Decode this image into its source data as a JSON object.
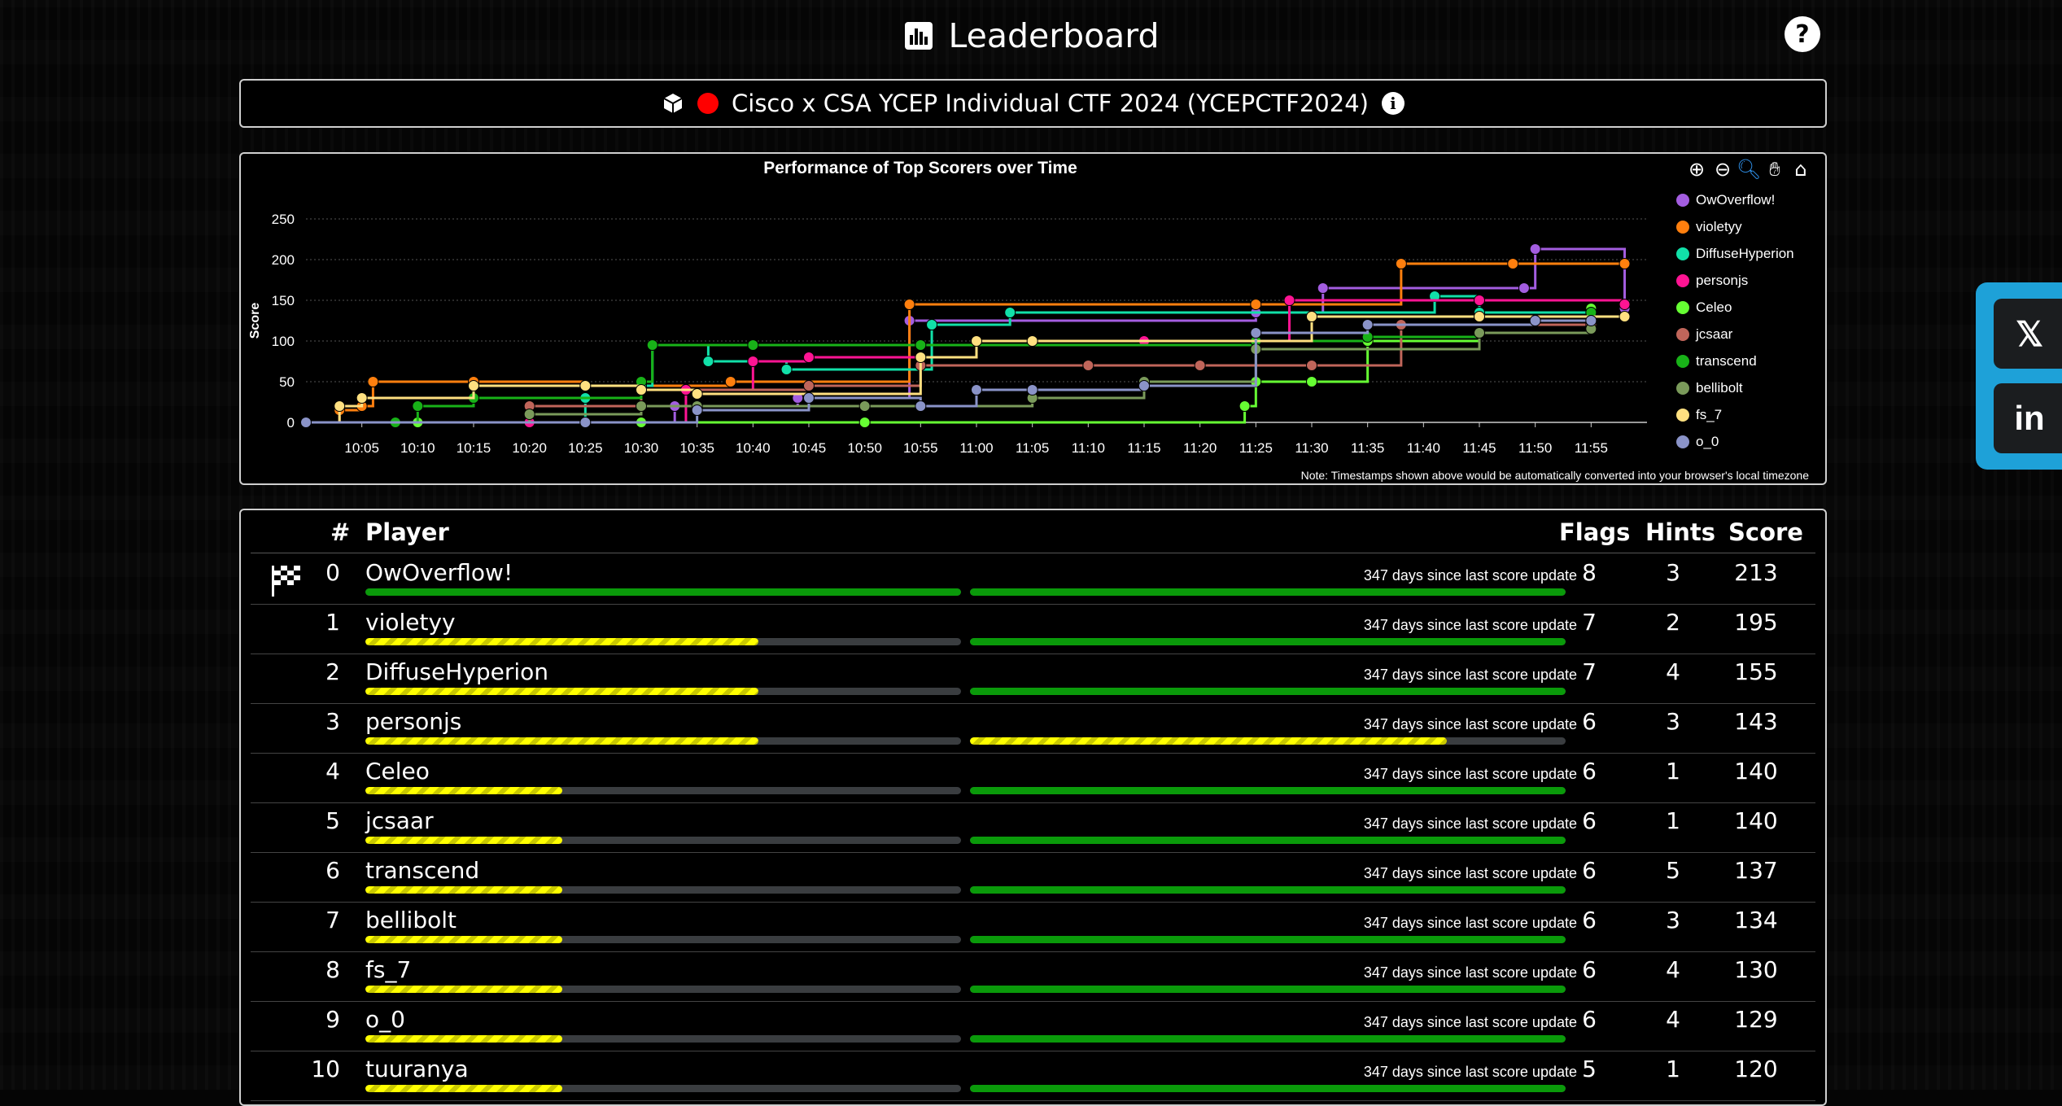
{
  "header": {
    "title": "Leaderboard",
    "help_label": "?"
  },
  "event": {
    "name": "Cisco x CSA YCEP Individual CTF 2024 (YCEPCTF2024)"
  },
  "chart": {
    "note": "Note: Timestamps shown above would be automatically converted into your browser's local timezone",
    "tools": [
      "zoom-in-icon",
      "zoom-out-icon",
      "selection-zoom-icon",
      "pan-icon",
      "home-icon"
    ]
  },
  "chart_data": {
    "type": "line",
    "title": "Performance of Top Scorers over Time",
    "xlabel": "",
    "ylabel": "Score",
    "ylim": [
      0,
      250
    ],
    "yticks": [
      0,
      50,
      100,
      150,
      200,
      250
    ],
    "xticks": [
      "10:05",
      "10:10",
      "10:15",
      "10:20",
      "10:25",
      "10:30",
      "10:35",
      "10:40",
      "10:45",
      "10:50",
      "10:55",
      "11:00",
      "11:05",
      "11:10",
      "11:15",
      "11:20",
      "11:25",
      "11:30",
      "11:35",
      "11:40",
      "11:45",
      "11:50",
      "11:55"
    ],
    "x_start": "10:00",
    "legend_position": "right",
    "grid": true,
    "series": [
      {
        "name": "OwOverflow!",
        "color": "#a35de0",
        "x": [
          "10:00",
          "10:33",
          "10:44",
          "10:54",
          "11:25",
          "11:31",
          "11:49",
          "11:50",
          "11:58"
        ],
        "y": [
          0,
          20,
          30,
          125,
          135,
          165,
          165,
          213,
          140
        ]
      },
      {
        "name": "violetyy",
        "color": "#ff7f0e",
        "x": [
          "10:00",
          "10:03",
          "10:05",
          "10:06",
          "10:15",
          "10:25",
          "10:38",
          "10:54",
          "11:25",
          "11:38",
          "11:48",
          "11:58"
        ],
        "y": [
          0,
          15,
          20,
          50,
          50,
          45,
          50,
          145,
          145,
          195,
          195,
          195
        ]
      },
      {
        "name": "DiffuseHyperion",
        "color": "#11e0a8",
        "x": [
          "10:00",
          "10:25",
          "10:30",
          "10:31",
          "10:36",
          "10:43",
          "10:56",
          "11:03",
          "11:41",
          "11:45",
          "11:55"
        ],
        "y": [
          0,
          30,
          45,
          95,
          75,
          65,
          120,
          135,
          155,
          135,
          140
        ]
      },
      {
        "name": "personjs",
        "color": "#ff1493",
        "x": [
          "10:00",
          "10:20",
          "10:34",
          "10:40",
          "10:45",
          "10:55",
          "11:00",
          "11:15",
          "11:28",
          "11:45",
          "11:58"
        ],
        "y": [
          0,
          0,
          40,
          75,
          80,
          80,
          100,
          100,
          150,
          150,
          145
        ]
      },
      {
        "name": "Celeo",
        "color": "#66ff33",
        "x": [
          "10:00",
          "10:10",
          "10:30",
          "10:50",
          "11:24",
          "11:25",
          "11:30",
          "11:35",
          "11:45",
          "11:55"
        ],
        "y": [
          0,
          0,
          0,
          0,
          20,
          50,
          50,
          100,
          110,
          140
        ]
      },
      {
        "name": "jcsaar",
        "color": "#c0655a",
        "x": [
          "10:00",
          "10:20",
          "10:30",
          "10:45",
          "10:55",
          "11:10",
          "11:20",
          "11:30",
          "11:38",
          "11:55"
        ],
        "y": [
          0,
          20,
          40,
          45,
          70,
          70,
          70,
          70,
          120,
          120
        ]
      },
      {
        "name": "transcend",
        "color": "#18b218",
        "x": [
          "10:00",
          "10:08",
          "10:10",
          "10:15",
          "10:30",
          "10:31",
          "10:40",
          "10:55",
          "11:25",
          "11:35",
          "11:45",
          "11:55"
        ],
        "y": [
          0,
          0,
          20,
          30,
          50,
          95,
          95,
          95,
          100,
          105,
          110,
          135
        ]
      },
      {
        "name": "bellibolt",
        "color": "#7a9a5a",
        "x": [
          "10:00",
          "10:20",
          "10:30",
          "10:35",
          "10:50",
          "11:05",
          "11:15",
          "11:25",
          "11:45",
          "11:55"
        ],
        "y": [
          0,
          10,
          20,
          20,
          20,
          30,
          50,
          90,
          110,
          115
        ]
      },
      {
        "name": "fs_7",
        "color": "#ffe080",
        "x": [
          "10:00",
          "10:03",
          "10:05",
          "10:15",
          "10:25",
          "10:30",
          "10:35",
          "10:55",
          "11:00",
          "11:05",
          "11:30",
          "11:45",
          "11:58"
        ],
        "y": [
          0,
          20,
          30,
          45,
          45,
          40,
          35,
          80,
          100,
          100,
          130,
          130,
          130
        ]
      },
      {
        "name": "o_0",
        "color": "#8a93c8",
        "x": [
          "10:00",
          "10:25",
          "10:35",
          "10:45",
          "10:55",
          "11:00",
          "11:05",
          "11:15",
          "11:25",
          "11:35",
          "11:50",
          "11:55"
        ],
        "y": [
          0,
          0,
          15,
          30,
          20,
          40,
          40,
          45,
          110,
          120,
          125,
          125
        ]
      }
    ]
  },
  "board": {
    "headers": {
      "rank": "#",
      "player": "Player",
      "flags": "Flags",
      "hints": "Hints",
      "score": "Score"
    },
    "rows": [
      {
        "rank": "0",
        "player": "OwOverflow!",
        "since": "347 days since last score update",
        "flags": "8",
        "hints": "3",
        "score": "213",
        "bar1": 1.0,
        "bar1_color": "green",
        "bar2": 1.0,
        "bar2_color": "green"
      },
      {
        "rank": "1",
        "player": "violetyy",
        "since": "347 days since last score update",
        "flags": "7",
        "hints": "2",
        "score": "195",
        "bar1": 0.66,
        "bar1_color": "yellow",
        "bar2": 1.0,
        "bar2_color": "green"
      },
      {
        "rank": "2",
        "player": "DiffuseHyperion",
        "since": "347 days since last score update",
        "flags": "7",
        "hints": "4",
        "score": "155",
        "bar1": 0.66,
        "bar1_color": "yellow",
        "bar2": 1.0,
        "bar2_color": "green"
      },
      {
        "rank": "3",
        "player": "personjs",
        "since": "347 days since last score update",
        "flags": "6",
        "hints": "3",
        "score": "143",
        "bar1": 0.66,
        "bar1_color": "yellow",
        "bar2": 0.8,
        "bar2_color": "yellow"
      },
      {
        "rank": "4",
        "player": "Celeo",
        "since": "347 days since last score update",
        "flags": "6",
        "hints": "1",
        "score": "140",
        "bar1": 0.33,
        "bar1_color": "yellow",
        "bar2": 1.0,
        "bar2_color": "green"
      },
      {
        "rank": "5",
        "player": "jcsaar",
        "since": "347 days since last score update",
        "flags": "6",
        "hints": "1",
        "score": "140",
        "bar1": 0.33,
        "bar1_color": "yellow",
        "bar2": 1.0,
        "bar2_color": "green"
      },
      {
        "rank": "6",
        "player": "transcend",
        "since": "347 days since last score update",
        "flags": "6",
        "hints": "5",
        "score": "137",
        "bar1": 0.33,
        "bar1_color": "yellow",
        "bar2": 1.0,
        "bar2_color": "green"
      },
      {
        "rank": "7",
        "player": "bellibolt",
        "since": "347 days since last score update",
        "flags": "6",
        "hints": "3",
        "score": "134",
        "bar1": 0.33,
        "bar1_color": "yellow",
        "bar2": 1.0,
        "bar2_color": "green"
      },
      {
        "rank": "8",
        "player": "fs_7",
        "since": "347 days since last score update",
        "flags": "6",
        "hints": "4",
        "score": "130",
        "bar1": 0.33,
        "bar1_color": "yellow",
        "bar2": 1.0,
        "bar2_color": "green"
      },
      {
        "rank": "9",
        "player": "o_0",
        "since": "347 days since last score update",
        "flags": "6",
        "hints": "4",
        "score": "129",
        "bar1": 0.33,
        "bar1_color": "yellow",
        "bar2": 1.0,
        "bar2_color": "green"
      },
      {
        "rank": "10",
        "player": "tuuranya",
        "since": "347 days since last score update",
        "flags": "5",
        "hints": "1",
        "score": "120",
        "bar1": 0.33,
        "bar1_color": "yellow",
        "bar2": 1.0,
        "bar2_color": "green"
      }
    ]
  },
  "social": {
    "x_label": "𝕏",
    "linkedin_label": "in"
  }
}
